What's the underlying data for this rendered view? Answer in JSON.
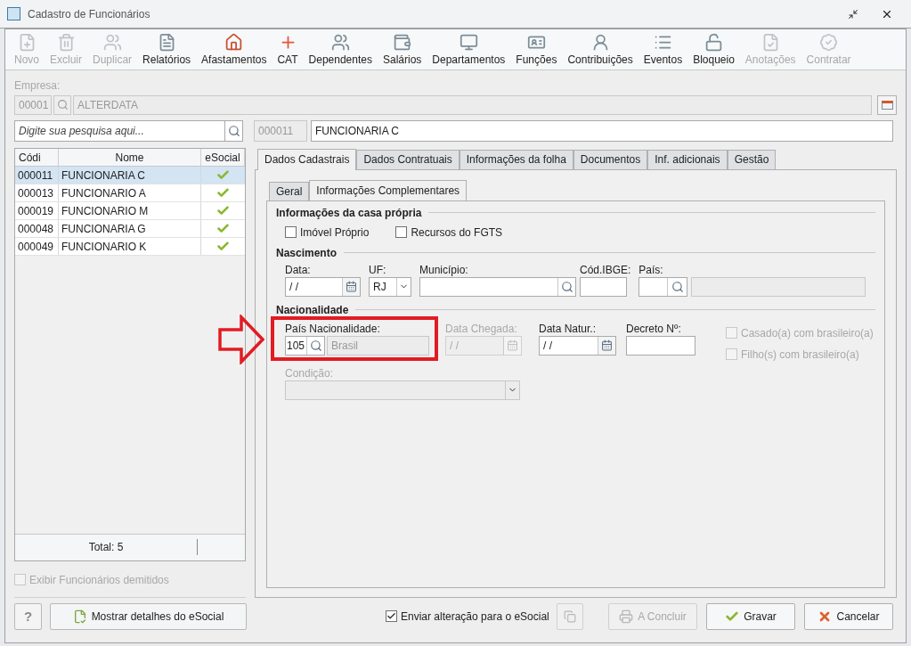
{
  "window": {
    "title": "Cadastro de Funcionários"
  },
  "toolbar": [
    {
      "label": "Novo",
      "disabled": true
    },
    {
      "label": "Excluir",
      "disabled": true
    },
    {
      "label": "Duplicar",
      "disabled": true
    },
    {
      "label": "Relatórios",
      "disabled": false
    },
    {
      "label": "Afastamentos",
      "disabled": false
    },
    {
      "label": "CAT",
      "disabled": false
    },
    {
      "label": "Dependentes",
      "disabled": false
    },
    {
      "label": "Salários",
      "disabled": false
    },
    {
      "label": "Departamentos",
      "disabled": false
    },
    {
      "label": "Funções",
      "disabled": false
    },
    {
      "label": "Contribuições",
      "disabled": false
    },
    {
      "label": "Eventos",
      "disabled": false
    },
    {
      "label": "Bloqueio",
      "disabled": false
    },
    {
      "label": "Anotações",
      "disabled": true
    },
    {
      "label": "Contratar",
      "disabled": true
    }
  ],
  "empresa": {
    "label": "Empresa:",
    "code": "00001",
    "name": "ALTERDATA"
  },
  "search": {
    "placeholder": "Digite sua pesquisa aqui..."
  },
  "current": {
    "code": "000011",
    "name": "FUNCIONARIA C"
  },
  "employees": {
    "columns": [
      "Códi",
      "Nome",
      "eSocial"
    ],
    "rows": [
      {
        "code": "000011",
        "name": "FUNCIONARIA C",
        "esocial": true,
        "selected": true
      },
      {
        "code": "000013",
        "name": "FUNCIONARIO A",
        "esocial": true,
        "selected": false
      },
      {
        "code": "000019",
        "name": "FUNCIONARIO M",
        "esocial": true,
        "selected": false
      },
      {
        "code": "000048",
        "name": "FUNCIONARIA G",
        "esocial": true,
        "selected": false
      },
      {
        "code": "000049",
        "name": "FUNCIONARIO K",
        "esocial": true,
        "selected": false
      }
    ],
    "total": "Total: 5"
  },
  "show_dismissed": {
    "label": "Exibir Funcionários demitidos",
    "checked": false,
    "disabled": true
  },
  "tabs": [
    {
      "label": "Dados Cadastrais",
      "selected": true
    },
    {
      "label": "Dados Contratuais",
      "selected": false
    },
    {
      "label": "Informações da folha",
      "selected": false
    },
    {
      "label": "Documentos",
      "selected": false
    },
    {
      "label": "Inf. adicionais",
      "selected": false
    },
    {
      "label": "Gestão",
      "selected": false
    }
  ],
  "subtabs": [
    {
      "label": "Geral",
      "selected": false
    },
    {
      "label": "Informações Complementares",
      "selected": true
    }
  ],
  "casa_propria": {
    "title": "Informações da casa própria",
    "checkboxes": [
      {
        "label": "Imóvel Próprio",
        "checked": false
      },
      {
        "label": "Recursos do FGTS",
        "checked": false
      }
    ]
  },
  "nascimento": {
    "title": "Nascimento",
    "data": {
      "label": "Data:",
      "value": "/ /"
    },
    "uf": {
      "label": "UF:",
      "value": "RJ"
    },
    "municipio": {
      "label": "Município:"
    },
    "cod_ibge": {
      "label": "Cód.IBGE:"
    },
    "pais": {
      "label": "País:"
    }
  },
  "nacionalidade": {
    "title": "Nacionalidade",
    "pais": {
      "label": "País Nacionalidade:",
      "code": "105",
      "name": "Brasil"
    },
    "data_chegada": {
      "label": "Data Chegada:",
      "value": "/ /",
      "disabled": true
    },
    "data_natur": {
      "label": "Data Natur.:",
      "value": "/ /",
      "disabled": false
    },
    "decreto": {
      "label": "Decreto Nº:"
    },
    "condicao": {
      "label": "Condição:",
      "disabled": true
    },
    "checkboxes": [
      {
        "label": "Casado(a) com brasileiro(a)",
        "checked": false,
        "disabled": true
      },
      {
        "label": "Filho(s) com brasileiro(a)",
        "checked": false,
        "disabled": true
      }
    ]
  },
  "footer": {
    "help": "?",
    "esocial_details": "Mostrar detalhes do eSocial",
    "send": {
      "label": "Enviar alteração para o eSocial",
      "checked": true
    },
    "buttons": [
      {
        "kind": "conclude",
        "label": "A Concluir",
        "disabled": true
      },
      {
        "kind": "save",
        "label": "Gravar",
        "disabled": false
      },
      {
        "kind": "cancel",
        "label": "Cancelar",
        "disabled": false
      }
    ]
  }
}
